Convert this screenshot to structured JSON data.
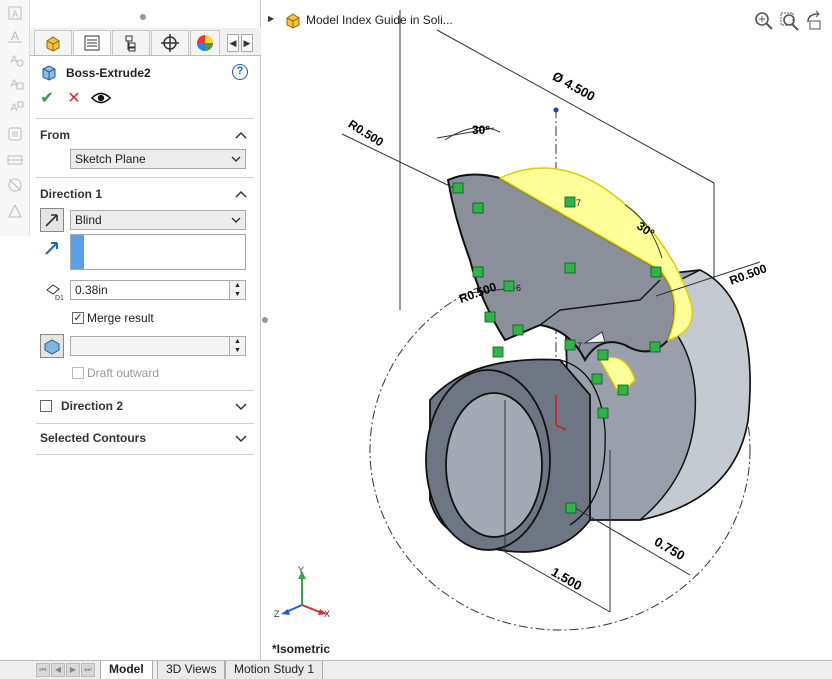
{
  "icons": {
    "pm_tabs": [
      "feature-manager-icon",
      "property-manager-icon",
      "configuration-manager-icon",
      "dimxpert-icon",
      "display-manager-icon"
    ],
    "left_tools": [
      "sketch-text-icon",
      "annotation-icon",
      "smart-dimension-icon",
      "note-icon",
      "balloon-icon",
      "surface-finish-icon",
      "weld-symbol-icon",
      "hole-callout-icon"
    ]
  },
  "property_manager": {
    "title": "Boss-Extrude2",
    "help": "?",
    "actions": {
      "ok": "✔",
      "cancel": "✕",
      "preview": "👁"
    },
    "from": {
      "header": "From",
      "start_condition": "Sketch Plane"
    },
    "direction1": {
      "header": "Direction 1",
      "end_condition": "Blind",
      "depth": "0.38in",
      "merge_label": "Merge result",
      "merge_checked": true,
      "draft_value": "",
      "draft_outward_label": "Draft outward",
      "draft_outward_checked": false
    },
    "direction2": {
      "header": "Direction 2",
      "checked": false
    },
    "selected_contours": {
      "header": "Selected Contours"
    }
  },
  "graphics": {
    "tree_item": "Model Index Guide in Soli...",
    "view_name": "*Isometric",
    "dimensions": {
      "dia": "Ø 4.500",
      "r1": "R0.500",
      "r2": "R0.500",
      "r3": "R0.500",
      "ang1": "30°",
      "ang2": "30°",
      "len1": "1.500",
      "len2": "0.750"
    },
    "relation_labels": [
      "7",
      "6",
      "7"
    ],
    "triad": {
      "x": "X",
      "y": "Y",
      "z": "Z"
    }
  },
  "bottom_tabs": [
    "Model",
    "3D Views",
    "Motion Study 1"
  ],
  "active_tab": "Model",
  "colors": {
    "part_gray": "#6f7683",
    "part_face_light": "#9aa0ab",
    "highlight_yellow": "#ffff99",
    "relation_green": "#2fb34a",
    "accent_blue": "#1b5fa8",
    "selection_blue": "#5aa0e6"
  }
}
